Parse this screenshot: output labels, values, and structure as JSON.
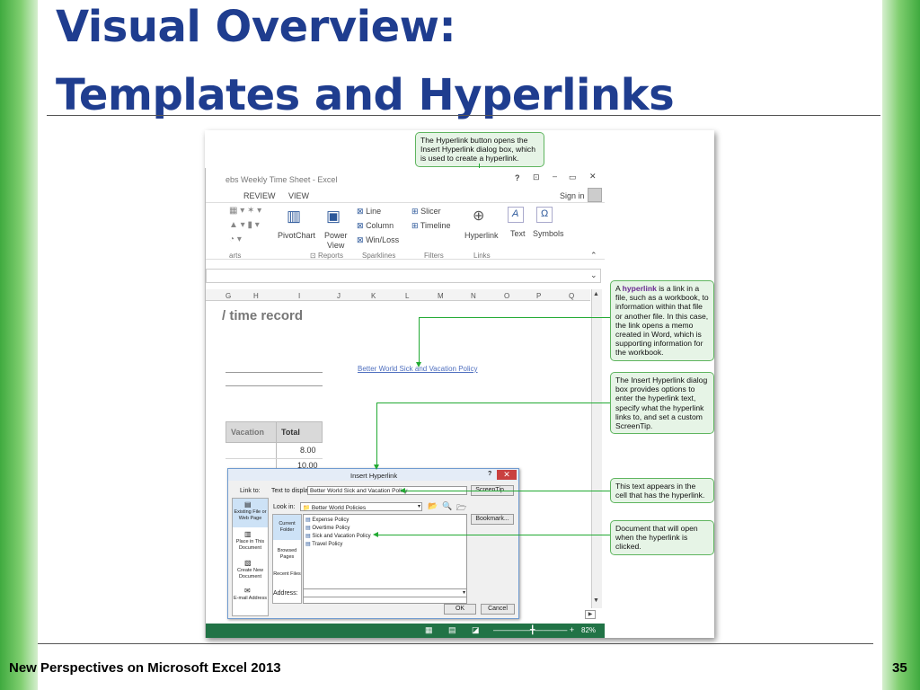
{
  "slide": {
    "title_line1": "Visual Overview:",
    "title_line2": "Templates and Hyperlinks",
    "footer_left": "New Perspectives on Microsoft Excel 2013",
    "page_number": "35"
  },
  "excel": {
    "window_title": "ebs Weekly Time Sheet - Excel",
    "help": "?",
    "signin": "Sign in",
    "tabs": [
      "REVIEW",
      "VIEW"
    ],
    "ribbon": {
      "pivotchart": "PivotChart",
      "power_view_1": "Power",
      "power_view_2": "View",
      "line": "Line",
      "column": "Column",
      "winloss": "Win/Loss",
      "slicer": "Slicer",
      "timeline": "Timeline",
      "hyperlink": "Hyperlink",
      "text": "Text",
      "symbols": "Symbols",
      "group_charts": "arts",
      "group_reports": "Reports",
      "group_sparklines": "Sparklines",
      "group_filters": "Filters",
      "group_links": "Links"
    },
    "columns": [
      "G",
      "H",
      "I",
      "J",
      "K",
      "L",
      "M",
      "N",
      "O",
      "P",
      "Q"
    ],
    "heading": "/ time record",
    "hyperlink_text": "Better World Sick and Vacation Policy",
    "table": {
      "col_vacation": "Vacation",
      "col_total": "Total",
      "values": [
        "8.00",
        "10.00"
      ]
    },
    "zoom": "82%"
  },
  "dialog": {
    "title": "Insert Hyperlink",
    "help": "?",
    "close": "✕",
    "link_to": "Link to:",
    "text_to_display_label": "Text to display:",
    "text_to_display_value": "Better World Sick and Vacation Policy",
    "screentip": "ScreenTip...",
    "look_in_label": "Look in:",
    "look_in_value": "Better World Policies",
    "bookmark": "Bookmark...",
    "address_label": "Address:",
    "ok": "OK",
    "cancel": "Cancel",
    "link_options": [
      "Existing File or Web Page",
      "Place in This Document",
      "Create New Document",
      "E-mail Address"
    ],
    "browse_options": [
      "Current Folder",
      "Browsed Pages",
      "Recent Files"
    ],
    "files": [
      "Expense Policy",
      "Overtime Policy",
      "Sick and Vacation Policy",
      "Travel Policy"
    ]
  },
  "callouts": {
    "hyperlink_button": "The Hyperlink button opens the Insert Hyperlink dialog box, which is used to create a hyperlink.",
    "hyperlink_def_prefix": "A ",
    "hyperlink_def_term": "hyperlink",
    "hyperlink_def_rest": " is a link in a file, such as a workbook, to information within that file or another file. In this case, the link opens a memo created in Word, which is supporting information for the workbook.",
    "dialog_desc": "The Insert Hyperlink dialog box provides options to enter the hyperlink text, specify what the hyperlink links to, and set a custom ScreenTip.",
    "text_appears": "This text appears in the cell that has the hyperlink.",
    "document_open": "Document that will open when the hyperlink is clicked."
  },
  "colors": {
    "title": "#1f3d8f",
    "callout_fill": "#e6f4e6",
    "callout_border": "#5fb55f",
    "excel_green": "#217346",
    "hyperlink_term": "#6a2c91"
  }
}
